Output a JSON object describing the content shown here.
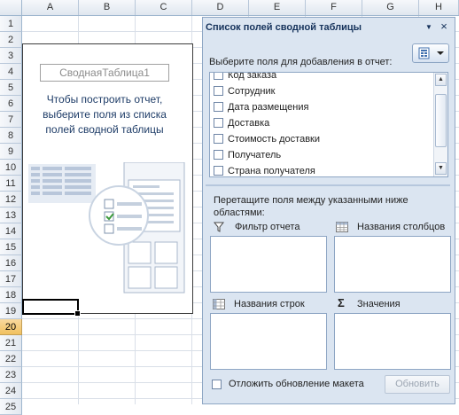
{
  "sheet": {
    "columns": [
      "A",
      "B",
      "C",
      "D",
      "E",
      "F",
      "G",
      "H"
    ],
    "rows": [
      "1",
      "2",
      "3",
      "4",
      "5",
      "6",
      "7",
      "8",
      "9",
      "10",
      "11",
      "12",
      "13",
      "14",
      "15",
      "16",
      "17",
      "18",
      "19",
      "20",
      "21",
      "22",
      "23",
      "24",
      "25"
    ],
    "selected_row": "20"
  },
  "pivot_placeholder": {
    "name": "СводнаяТаблица1",
    "message": "Чтобы построить отчет,\nвыберите поля из списка\nполей сводной таблицы"
  },
  "field_pane": {
    "title": "Список полей сводной таблицы",
    "choose_label": "Выберите поля для добавления в отчет:",
    "fields": [
      "Код заказа",
      "Сотрудник",
      "Дата размещения",
      "Доставка",
      "Стоимость доставки",
      "Получатель",
      "Страна получателя"
    ],
    "drag_label": "Перетащите поля между указанными ниже\nобластями:",
    "areas": {
      "report_filter": "Фильтр отчета",
      "column_labels": "Названия столбцов",
      "row_labels": "Названия строк",
      "values": "Значения"
    },
    "defer_label": "Отложить обновление макета",
    "update_button": "Обновить"
  },
  "icons": {
    "dropdown": "chevron-down-icon",
    "close": "close-icon",
    "filter": "filter-icon",
    "column": "column-grid-icon",
    "row": "row-grid-icon",
    "sum": "sigma-icon"
  }
}
